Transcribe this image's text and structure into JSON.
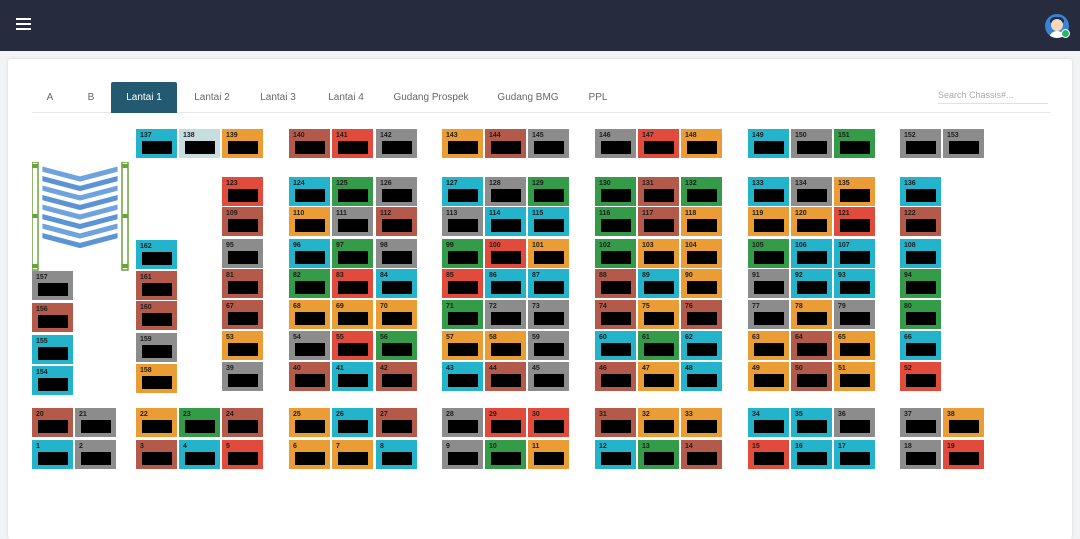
{
  "header": {
    "menu_icon": "hamburger-icon",
    "avatar_icon": "user-avatar-icon"
  },
  "tabs": [
    {
      "label": "A"
    },
    {
      "label": "B"
    },
    {
      "label": "Lantai 1",
      "active": true
    },
    {
      "label": "Lantai 2"
    },
    {
      "label": "Lantai 3"
    },
    {
      "label": "Lantai 4"
    },
    {
      "label": "Gudang Prospek"
    },
    {
      "label": "Gudang BMG"
    },
    {
      "label": "PPL"
    }
  ],
  "search": {
    "placeholder": "Search Chassis#...",
    "value": ""
  },
  "colors": {
    "teal": "#23b4cb",
    "rust": "#b35a4a",
    "red": "#e14b3b",
    "gray": "#8c8c8c",
    "orange": "#eb9d35",
    "green": "#349b48",
    "pale": "#c8dde0",
    "tab_active": "#235a72",
    "topbar": "#262b3e"
  },
  "slots": [
    {
      "n": "137",
      "c": "teal"
    },
    {
      "n": "138",
      "c": "pale"
    },
    {
      "n": "139",
      "c": "orange"
    },
    {
      "n": "140",
      "c": "rust"
    },
    {
      "n": "141",
      "c": "red"
    },
    {
      "n": "142",
      "c": "gray"
    },
    {
      "n": "143",
      "c": "orange"
    },
    {
      "n": "144",
      "c": "rust"
    },
    {
      "n": "145",
      "c": "gray"
    },
    {
      "n": "146",
      "c": "gray"
    },
    {
      "n": "147",
      "c": "red"
    },
    {
      "n": "148",
      "c": "orange"
    },
    {
      "n": "149",
      "c": "teal"
    },
    {
      "n": "150",
      "c": "gray"
    },
    {
      "n": "151",
      "c": "green"
    },
    {
      "n": "152",
      "c": "gray"
    },
    {
      "n": "153",
      "c": "gray"
    },
    {
      "n": "123",
      "c": "red"
    },
    {
      "n": "124",
      "c": "teal"
    },
    {
      "n": "125",
      "c": "green"
    },
    {
      "n": "126",
      "c": "gray"
    },
    {
      "n": "127",
      "c": "teal"
    },
    {
      "n": "128",
      "c": "gray"
    },
    {
      "n": "129",
      "c": "green"
    },
    {
      "n": "130",
      "c": "green"
    },
    {
      "n": "131",
      "c": "rust"
    },
    {
      "n": "132",
      "c": "green"
    },
    {
      "n": "133",
      "c": "teal"
    },
    {
      "n": "134",
      "c": "gray"
    },
    {
      "n": "135",
      "c": "orange"
    },
    {
      "n": "136",
      "c": "teal"
    },
    {
      "n": "109",
      "c": "rust"
    },
    {
      "n": "110",
      "c": "orange"
    },
    {
      "n": "111",
      "c": "gray"
    },
    {
      "n": "112",
      "c": "rust"
    },
    {
      "n": "113",
      "c": "gray"
    },
    {
      "n": "114",
      "c": "teal"
    },
    {
      "n": "115",
      "c": "teal"
    },
    {
      "n": "116",
      "c": "green"
    },
    {
      "n": "117",
      "c": "rust"
    },
    {
      "n": "118",
      "c": "orange"
    },
    {
      "n": "119",
      "c": "orange"
    },
    {
      "n": "120",
      "c": "orange"
    },
    {
      "n": "121",
      "c": "red"
    },
    {
      "n": "122",
      "c": "rust"
    },
    {
      "n": "162",
      "c": "teal"
    },
    {
      "n": "95",
      "c": "gray"
    },
    {
      "n": "96",
      "c": "teal"
    },
    {
      "n": "97",
      "c": "green"
    },
    {
      "n": "98",
      "c": "gray"
    },
    {
      "n": "99",
      "c": "green"
    },
    {
      "n": "100",
      "c": "red"
    },
    {
      "n": "101",
      "c": "orange"
    },
    {
      "n": "102",
      "c": "green"
    },
    {
      "n": "103",
      "c": "orange"
    },
    {
      "n": "104",
      "c": "orange"
    },
    {
      "n": "105",
      "c": "green"
    },
    {
      "n": "106",
      "c": "teal"
    },
    {
      "n": "107",
      "c": "teal"
    },
    {
      "n": "108",
      "c": "teal"
    },
    {
      "n": "157",
      "c": "gray"
    },
    {
      "n": "161",
      "c": "rust"
    },
    {
      "n": "81",
      "c": "rust"
    },
    {
      "n": "82",
      "c": "green"
    },
    {
      "n": "83",
      "c": "red"
    },
    {
      "n": "84",
      "c": "teal"
    },
    {
      "n": "85",
      "c": "red"
    },
    {
      "n": "86",
      "c": "teal"
    },
    {
      "n": "87",
      "c": "teal"
    },
    {
      "n": "88",
      "c": "rust"
    },
    {
      "n": "89",
      "c": "teal"
    },
    {
      "n": "90",
      "c": "orange"
    },
    {
      "n": "91",
      "c": "gray"
    },
    {
      "n": "92",
      "c": "teal"
    },
    {
      "n": "93",
      "c": "teal"
    },
    {
      "n": "94",
      "c": "green"
    },
    {
      "n": "156",
      "c": "rust"
    },
    {
      "n": "160",
      "c": "rust"
    },
    {
      "n": "67",
      "c": "rust"
    },
    {
      "n": "68",
      "c": "orange"
    },
    {
      "n": "69",
      "c": "orange"
    },
    {
      "n": "70",
      "c": "orange"
    },
    {
      "n": "71",
      "c": "green"
    },
    {
      "n": "72",
      "c": "gray"
    },
    {
      "n": "73",
      "c": "gray"
    },
    {
      "n": "74",
      "c": "rust"
    },
    {
      "n": "75",
      "c": "orange"
    },
    {
      "n": "76",
      "c": "rust"
    },
    {
      "n": "77",
      "c": "gray"
    },
    {
      "n": "78",
      "c": "orange"
    },
    {
      "n": "79",
      "c": "gray"
    },
    {
      "n": "80",
      "c": "green"
    },
    {
      "n": "155",
      "c": "teal"
    },
    {
      "n": "159",
      "c": "gray"
    },
    {
      "n": "53",
      "c": "orange"
    },
    {
      "n": "54",
      "c": "gray"
    },
    {
      "n": "55",
      "c": "red"
    },
    {
      "n": "56",
      "c": "green"
    },
    {
      "n": "57",
      "c": "orange"
    },
    {
      "n": "58",
      "c": "orange"
    },
    {
      "n": "59",
      "c": "gray"
    },
    {
      "n": "60",
      "c": "teal"
    },
    {
      "n": "61",
      "c": "green"
    },
    {
      "n": "62",
      "c": "teal"
    },
    {
      "n": "63",
      "c": "orange"
    },
    {
      "n": "64",
      "c": "rust"
    },
    {
      "n": "65",
      "c": "orange"
    },
    {
      "n": "66",
      "c": "teal"
    },
    {
      "n": "154",
      "c": "teal"
    },
    {
      "n": "158",
      "c": "orange"
    },
    {
      "n": "39",
      "c": "gray"
    },
    {
      "n": "40",
      "c": "rust"
    },
    {
      "n": "41",
      "c": "teal"
    },
    {
      "n": "42",
      "c": "rust"
    },
    {
      "n": "43",
      "c": "teal"
    },
    {
      "n": "44",
      "c": "rust"
    },
    {
      "n": "45",
      "c": "gray"
    },
    {
      "n": "46",
      "c": "rust"
    },
    {
      "n": "47",
      "c": "orange"
    },
    {
      "n": "48",
      "c": "teal"
    },
    {
      "n": "49",
      "c": "orange"
    },
    {
      "n": "50",
      "c": "rust"
    },
    {
      "n": "51",
      "c": "orange"
    },
    {
      "n": "52",
      "c": "red"
    },
    {
      "n": "20",
      "c": "rust"
    },
    {
      "n": "21",
      "c": "gray"
    },
    {
      "n": "22",
      "c": "orange"
    },
    {
      "n": "23",
      "c": "green"
    },
    {
      "n": "24",
      "c": "rust"
    },
    {
      "n": "25",
      "c": "orange"
    },
    {
      "n": "26",
      "c": "teal"
    },
    {
      "n": "27",
      "c": "rust"
    },
    {
      "n": "28",
      "c": "gray"
    },
    {
      "n": "29",
      "c": "red"
    },
    {
      "n": "30",
      "c": "red"
    },
    {
      "n": "31",
      "c": "rust"
    },
    {
      "n": "32",
      "c": "orange"
    },
    {
      "n": "33",
      "c": "orange"
    },
    {
      "n": "34",
      "c": "teal"
    },
    {
      "n": "35",
      "c": "teal"
    },
    {
      "n": "36",
      "c": "gray"
    },
    {
      "n": "37",
      "c": "gray"
    },
    {
      "n": "38",
      "c": "orange"
    },
    {
      "n": "1",
      "c": "teal"
    },
    {
      "n": "2",
      "c": "gray"
    },
    {
      "n": "3",
      "c": "rust"
    },
    {
      "n": "4",
      "c": "teal"
    },
    {
      "n": "5",
      "c": "red"
    },
    {
      "n": "6",
      "c": "orange"
    },
    {
      "n": "7",
      "c": "orange"
    },
    {
      "n": "8",
      "c": "teal"
    },
    {
      "n": "9",
      "c": "gray"
    },
    {
      "n": "10",
      "c": "green"
    },
    {
      "n": "11",
      "c": "orange"
    },
    {
      "n": "12",
      "c": "teal"
    },
    {
      "n": "13",
      "c": "green"
    },
    {
      "n": "14",
      "c": "rust"
    },
    {
      "n": "15",
      "c": "red"
    },
    {
      "n": "16",
      "c": "teal"
    },
    {
      "n": "17",
      "c": "teal"
    },
    {
      "n": "18",
      "c": "gray"
    },
    {
      "n": "19",
      "c": "red"
    }
  ]
}
